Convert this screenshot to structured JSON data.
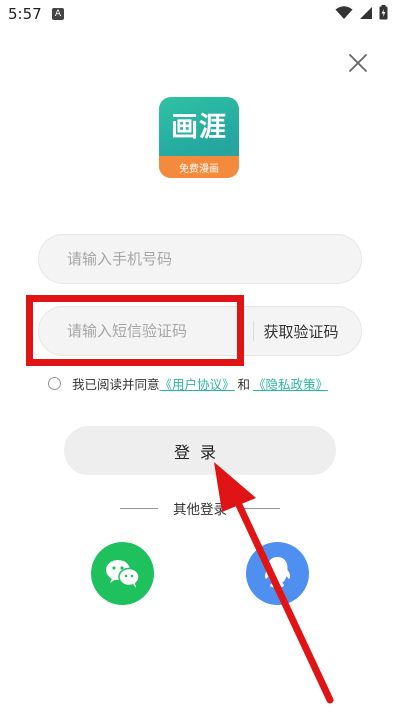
{
  "status_bar": {
    "time": "5:57",
    "notification_letter": "A",
    "icons": [
      "wifi-icon",
      "signal-icon",
      "battery-charging-icon"
    ]
  },
  "logo": {
    "title": "画涯",
    "subtitle": "免费漫画"
  },
  "form": {
    "phone_placeholder": "请输入手机号码",
    "code_placeholder": "请输入短信验证码",
    "get_code_label": "获取验证码"
  },
  "agreement": {
    "prefix": "我已阅读并同意",
    "user_agreement": "《用户协议》",
    "and": "和",
    "privacy_policy": "《隐私政策》"
  },
  "login": {
    "label": "登录"
  },
  "other_login": {
    "label": "其他登录",
    "options": [
      "wechat-icon",
      "qq-icon"
    ]
  },
  "colors": {
    "accent": "#2ab7a0",
    "annotation": "#e01414",
    "wechat": "#1fc15e",
    "qq": "#4f8ff0",
    "logo_band": "#f48b3c"
  }
}
